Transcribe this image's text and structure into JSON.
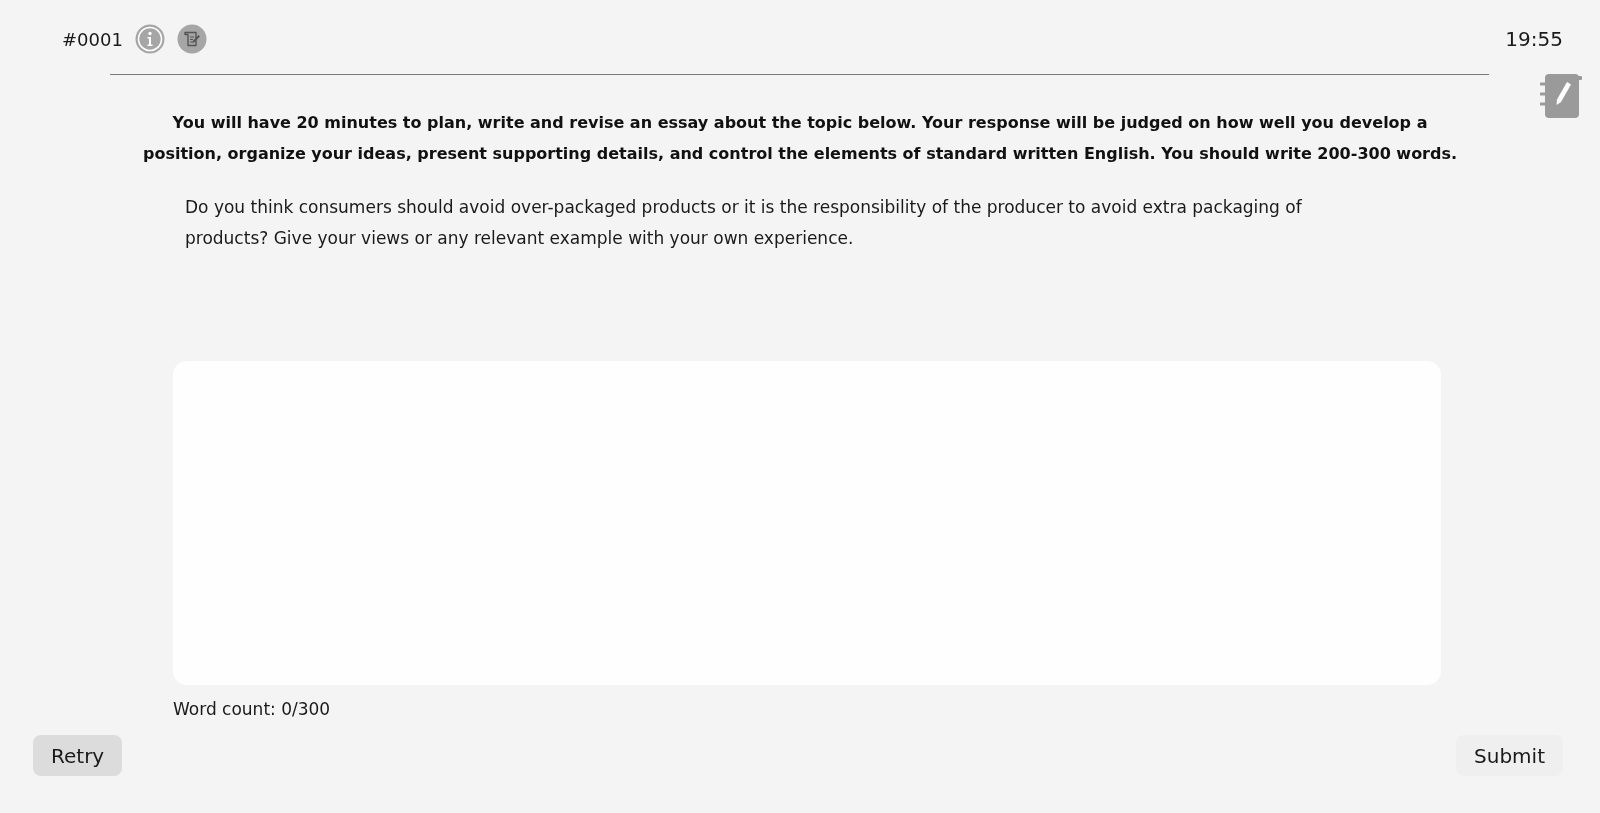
{
  "header": {
    "item_number": "#0001",
    "timer": "19:55"
  },
  "instructions": "You will have 20 minutes to plan, write and revise an essay about the topic below. Your response will be judged on how well you develop a position, organize your ideas, present supporting details, and control the elements of standard written English. You should write 200-300 words.",
  "prompt": "Do you think consumers should avoid over-packaged products or it is the responsibility of the producer to avoid extra packaging of products? Give your views or any relevant example with your own experience.",
  "word_count": "Word count: 0/300",
  "buttons": [
    {
      "label": "Retry",
      "kind": "filled"
    },
    {
      "label": "Submit",
      "kind": "plain"
    }
  ]
}
